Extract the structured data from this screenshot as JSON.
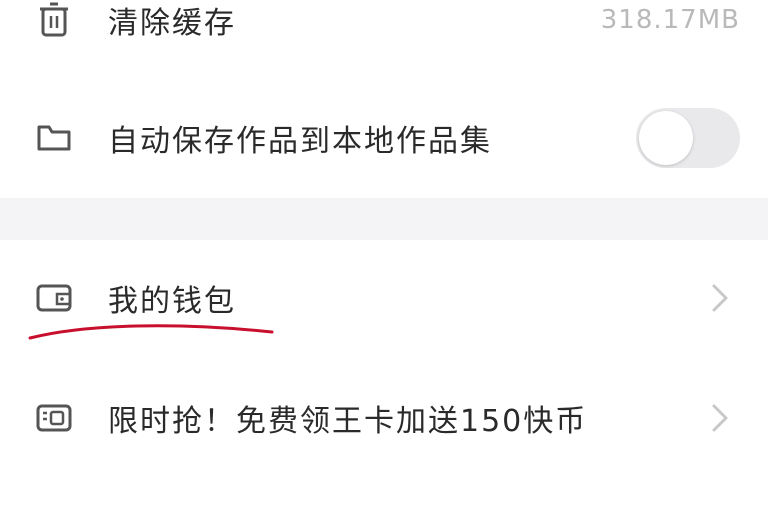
{
  "settings": {
    "clear_cache": {
      "label": "清除缓存",
      "value": "318.17MB",
      "icon": "trash-icon"
    },
    "auto_save": {
      "label": "自动保存作品到本地作品集",
      "icon": "folder-icon",
      "toggle_on": false
    },
    "wallet": {
      "label": "我的钱包",
      "icon": "wallet-icon"
    },
    "promo": {
      "label": "限时抢！免费领王卡加送150快币",
      "icon": "card-icon"
    }
  },
  "colors": {
    "annotation_underline": "#c8102e",
    "toggle_off": "#e9e9ec",
    "section_gap": "#f4f4f6"
  }
}
